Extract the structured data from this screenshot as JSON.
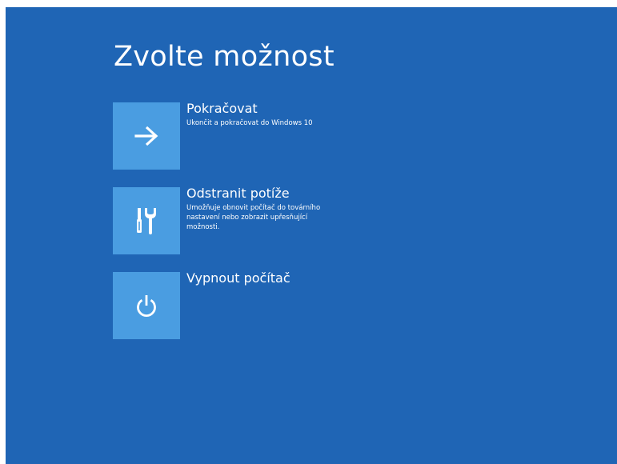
{
  "screen": {
    "title": "Zvolte možnost",
    "background_color": "#1f65b5",
    "tile_color": "#4a9de1"
  },
  "options": [
    {
      "icon": "arrow-right-icon",
      "label": "Pokračovat",
      "description": "Ukončit a pokračovat do Windows 10"
    },
    {
      "icon": "tools-icon",
      "label": "Odstranit potíže",
      "description": "Umožňuje obnovit počítač do továrního nastavení nebo zobrazit upřesňující možnosti."
    },
    {
      "icon": "power-icon",
      "label": "Vypnout počítač",
      "description": ""
    }
  ]
}
